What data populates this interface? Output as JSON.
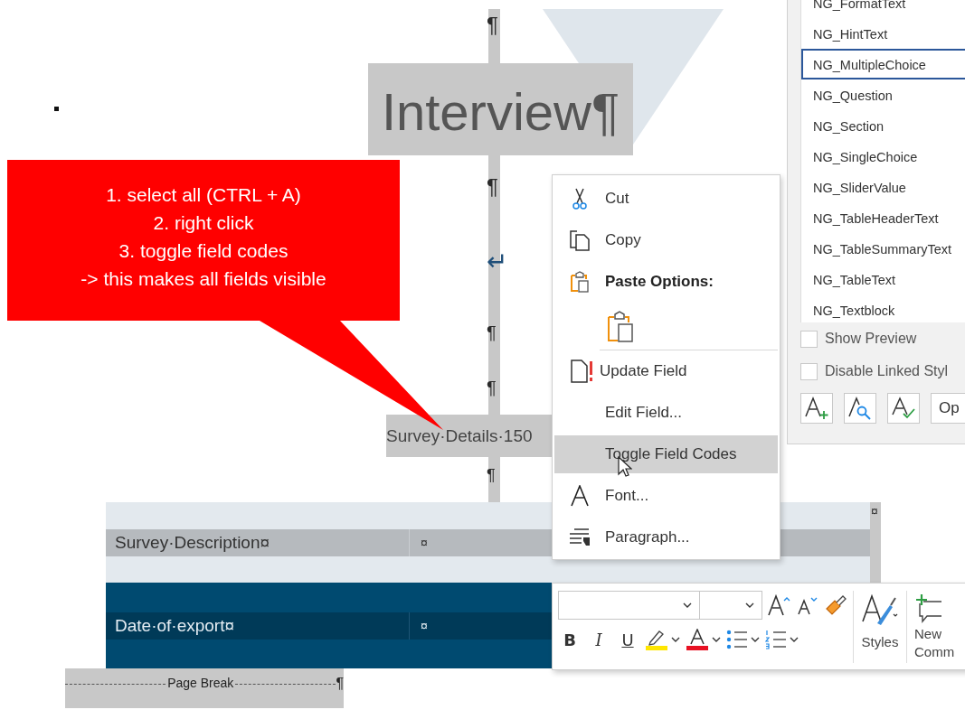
{
  "document": {
    "top_mark": "¶",
    "heading": "Interview¶",
    "marks": [
      "¶",
      "↵",
      "¶",
      "¶"
    ],
    "field": "Survey·Details·150",
    "after_field_mark": "¶",
    "table": {
      "rows": [
        {
          "kind": "light",
          "cells": [
            "Survey·Description¤",
            "¤"
          ]
        },
        {
          "kind": "dark",
          "cells": [
            "Date·of·export¤",
            "¤"
          ]
        }
      ],
      "end_mark": "¤"
    },
    "page_break": {
      "label": "Page Break",
      "mark": "¶"
    }
  },
  "callout": {
    "lines": [
      "1. select all (CTRL + A)",
      "2. right click",
      "3. toggle field codes",
      "-> this makes all fields visible"
    ]
  },
  "context_menu": {
    "items": [
      {
        "kind": "command",
        "label": "Cut",
        "selected": false
      },
      {
        "kind": "command",
        "label": "Copy",
        "selected": false
      },
      {
        "kind": "heading",
        "label": "Paste Options:"
      },
      {
        "kind": "paste-option"
      },
      {
        "kind": "command",
        "label": "Update Field",
        "selected": false
      },
      {
        "kind": "command",
        "label": "Edit Field...",
        "selected": false
      },
      {
        "kind": "command",
        "label": "Toggle Field Codes",
        "selected": true
      },
      {
        "kind": "command",
        "label": "Font...",
        "selected": false
      },
      {
        "kind": "command",
        "label": "Paragraph...",
        "selected": false
      }
    ]
  },
  "mini_toolbar": {
    "format_buttons": [
      "B",
      "I",
      "U"
    ],
    "styles_label": "Styles",
    "comment_label": "New Comm"
  },
  "styles_pane": {
    "items": [
      {
        "label": "NG_FormatText",
        "selected": false
      },
      {
        "label": "NG_HintText",
        "selected": false
      },
      {
        "label": "NG_MultipleChoice",
        "selected": true
      },
      {
        "label": "NG_Question",
        "selected": false
      },
      {
        "label": "NG_Section",
        "selected": false
      },
      {
        "label": "NG_SingleChoice",
        "selected": false
      },
      {
        "label": "NG_SliderValue",
        "selected": false
      },
      {
        "label": "NG_TableHeaderText",
        "selected": false
      },
      {
        "label": "NG_TableSummaryText",
        "selected": false
      },
      {
        "label": "NG_TableText",
        "selected": false
      },
      {
        "label": "NG_Textblock",
        "selected": false
      }
    ],
    "options": [
      {
        "label": "Show Preview",
        "checked": false
      },
      {
        "label": "Disable Linked Styl",
        "checked": false
      }
    ],
    "options_button": "Op"
  }
}
